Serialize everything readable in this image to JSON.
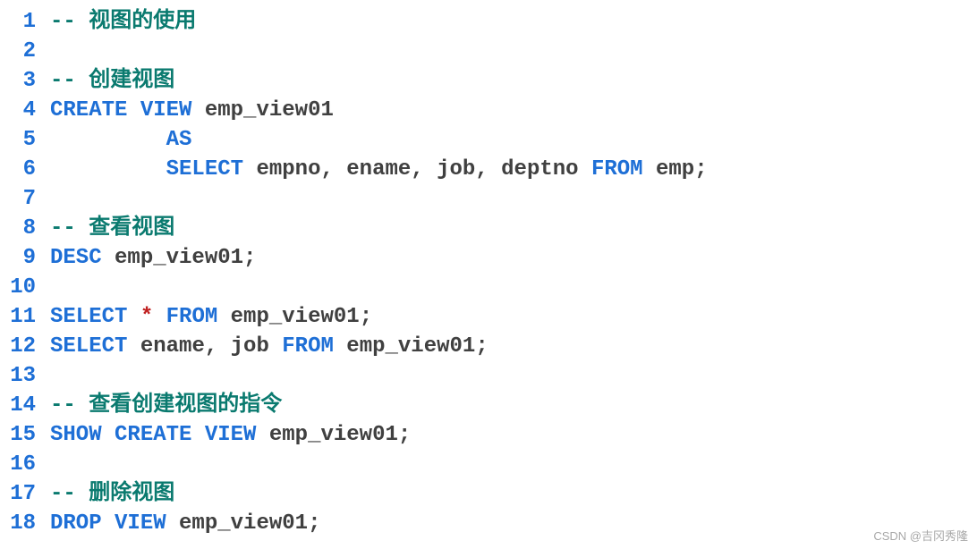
{
  "editor": {
    "lines": [
      {
        "num": "1",
        "tokens": [
          {
            "cls": "cm",
            "t": "-- 视图的使用"
          }
        ]
      },
      {
        "num": "2",
        "tokens": []
      },
      {
        "num": "3",
        "tokens": [
          {
            "cls": "cm",
            "t": "-- 创建视图"
          }
        ]
      },
      {
        "num": "4",
        "tokens": [
          {
            "cls": "kw",
            "t": "CREATE"
          },
          {
            "cls": "pn",
            "t": " "
          },
          {
            "cls": "kw",
            "t": "VIEW"
          },
          {
            "cls": "pn",
            "t": " "
          },
          {
            "cls": "id",
            "t": "emp_view01"
          }
        ]
      },
      {
        "num": "5",
        "tokens": [
          {
            "cls": "pn",
            "t": "         "
          },
          {
            "cls": "kw",
            "t": "AS"
          }
        ]
      },
      {
        "num": "6",
        "tokens": [
          {
            "cls": "pn",
            "t": "         "
          },
          {
            "cls": "kw",
            "t": "SELECT"
          },
          {
            "cls": "pn",
            "t": " "
          },
          {
            "cls": "id",
            "t": "empno"
          },
          {
            "cls": "pn",
            "t": ", "
          },
          {
            "cls": "id",
            "t": "ename"
          },
          {
            "cls": "pn",
            "t": ", "
          },
          {
            "cls": "id",
            "t": "job"
          },
          {
            "cls": "pn",
            "t": ", "
          },
          {
            "cls": "id",
            "t": "deptno"
          },
          {
            "cls": "pn",
            "t": " "
          },
          {
            "cls": "kw",
            "t": "FROM"
          },
          {
            "cls": "pn",
            "t": " "
          },
          {
            "cls": "id",
            "t": "emp"
          },
          {
            "cls": "pn",
            "t": ";"
          }
        ]
      },
      {
        "num": "7",
        "tokens": []
      },
      {
        "num": "8",
        "tokens": [
          {
            "cls": "cm",
            "t": "-- 查看视图"
          }
        ]
      },
      {
        "num": "9",
        "tokens": [
          {
            "cls": "kw",
            "t": "DESC"
          },
          {
            "cls": "pn",
            "t": " "
          },
          {
            "cls": "id",
            "t": "emp_view01"
          },
          {
            "cls": "pn",
            "t": ";"
          }
        ]
      },
      {
        "num": "10",
        "tokens": []
      },
      {
        "num": "11",
        "tokens": [
          {
            "cls": "kw",
            "t": "SELECT"
          },
          {
            "cls": "pn",
            "t": " "
          },
          {
            "cls": "op",
            "t": "*"
          },
          {
            "cls": "pn",
            "t": " "
          },
          {
            "cls": "kw",
            "t": "FROM"
          },
          {
            "cls": "pn",
            "t": " "
          },
          {
            "cls": "id",
            "t": "emp_view01"
          },
          {
            "cls": "pn",
            "t": ";"
          }
        ]
      },
      {
        "num": "12",
        "tokens": [
          {
            "cls": "kw",
            "t": "SELECT"
          },
          {
            "cls": "pn",
            "t": " "
          },
          {
            "cls": "id",
            "t": "ename"
          },
          {
            "cls": "pn",
            "t": ", "
          },
          {
            "cls": "id",
            "t": "job"
          },
          {
            "cls": "pn",
            "t": " "
          },
          {
            "cls": "kw",
            "t": "FROM"
          },
          {
            "cls": "pn",
            "t": " "
          },
          {
            "cls": "id",
            "t": "emp_view01"
          },
          {
            "cls": "pn",
            "t": ";"
          }
        ]
      },
      {
        "num": "13",
        "tokens": []
      },
      {
        "num": "14",
        "tokens": [
          {
            "cls": "cm",
            "t": "-- 查看创建视图的指令"
          }
        ]
      },
      {
        "num": "15",
        "tokens": [
          {
            "cls": "kw",
            "t": "SHOW"
          },
          {
            "cls": "pn",
            "t": " "
          },
          {
            "cls": "kw",
            "t": "CREATE"
          },
          {
            "cls": "pn",
            "t": " "
          },
          {
            "cls": "kw",
            "t": "VIEW"
          },
          {
            "cls": "pn",
            "t": " "
          },
          {
            "cls": "id",
            "t": "emp_view01"
          },
          {
            "cls": "pn",
            "t": ";"
          }
        ]
      },
      {
        "num": "16",
        "tokens": []
      },
      {
        "num": "17",
        "tokens": [
          {
            "cls": "cm",
            "t": "-- 删除视图"
          }
        ]
      },
      {
        "num": "18",
        "tokens": [
          {
            "cls": "kw",
            "t": "DROP"
          },
          {
            "cls": "pn",
            "t": " "
          },
          {
            "cls": "kw",
            "t": "VIEW"
          },
          {
            "cls": "pn",
            "t": " "
          },
          {
            "cls": "id",
            "t": "emp_view01"
          },
          {
            "cls": "pn",
            "t": ";"
          }
        ]
      }
    ]
  },
  "watermark": "CSDN @吉冈秀隆"
}
